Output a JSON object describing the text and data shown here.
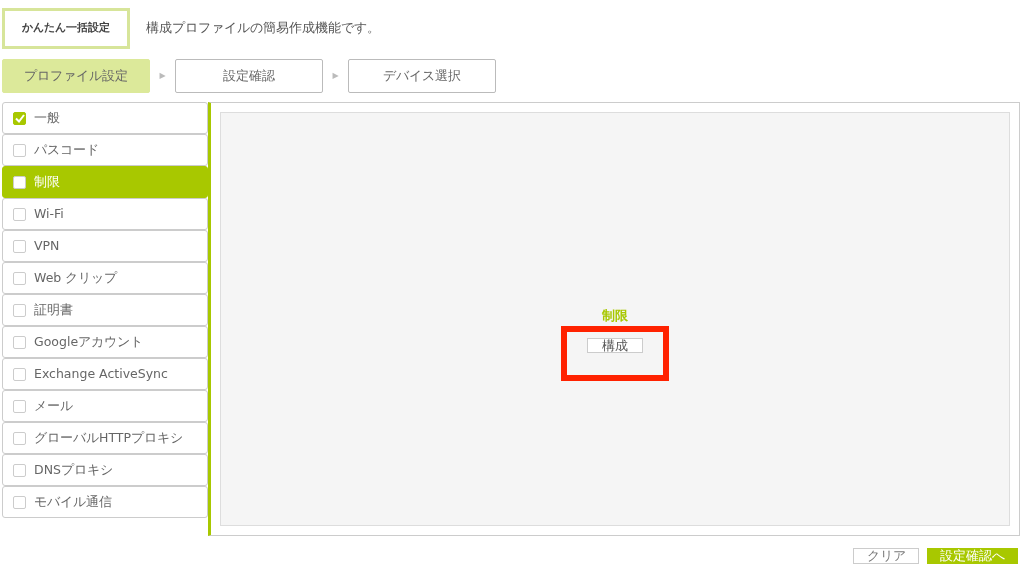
{
  "header": {
    "title": "かんたん一括設定",
    "description": "構成プロファイルの簡易作成機能です。"
  },
  "steps": [
    {
      "label": "プロファイル設定",
      "selected": true,
      "arrow": "▶"
    },
    {
      "label": "設定確認",
      "selected": false,
      "arrow": "▶"
    },
    {
      "label": "デバイス選択",
      "selected": false
    }
  ],
  "sidebar": {
    "items": [
      {
        "label": "一般",
        "checked": true,
        "selected": false
      },
      {
        "label": "パスコード",
        "checked": false,
        "selected": false
      },
      {
        "label": "制限",
        "checked": false,
        "selected": true
      },
      {
        "label": "Wi-Fi",
        "checked": false,
        "selected": false
      },
      {
        "label": "VPN",
        "checked": false,
        "selected": false
      },
      {
        "label": "Web クリップ",
        "checked": false,
        "selected": false
      },
      {
        "label": "証明書",
        "checked": false,
        "selected": false
      },
      {
        "label": "Googleアカウント",
        "checked": false,
        "selected": false
      },
      {
        "label": "Exchange ActiveSync",
        "checked": false,
        "selected": false
      },
      {
        "label": "メール",
        "checked": false,
        "selected": false
      },
      {
        "label": "グローバルHTTPプロキシ",
        "checked": false,
        "selected": false
      },
      {
        "label": "DNSプロキシ",
        "checked": false,
        "selected": false
      },
      {
        "label": "モバイル通信",
        "checked": false,
        "selected": false
      }
    ]
  },
  "panel": {
    "title": "制限",
    "button": {
      "label": "構成",
      "highlighted": true
    }
  },
  "footer": {
    "buttons": [
      {
        "label": "クリア",
        "kind": "secondary"
      },
      {
        "label": "設定確認へ",
        "kind": "primary"
      }
    ]
  }
}
